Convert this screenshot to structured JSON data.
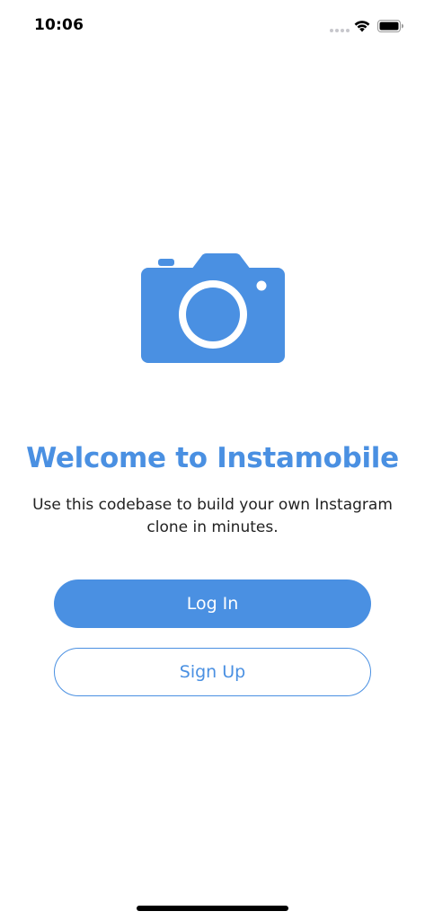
{
  "status_bar": {
    "time": "10:06",
    "icons": [
      "signal-icon",
      "wifi-icon",
      "battery-icon"
    ]
  },
  "hero": {
    "icon": "camera-icon",
    "title": "Welcome to Instamobile",
    "subtitle": "Use this codebase to build your own Instagram clone in minutes."
  },
  "buttons": {
    "login_label": "Log In",
    "signup_label": "Sign Up"
  },
  "colors": {
    "accent": "#4a90e2",
    "background": "#ffffff",
    "text": "#222222"
  }
}
